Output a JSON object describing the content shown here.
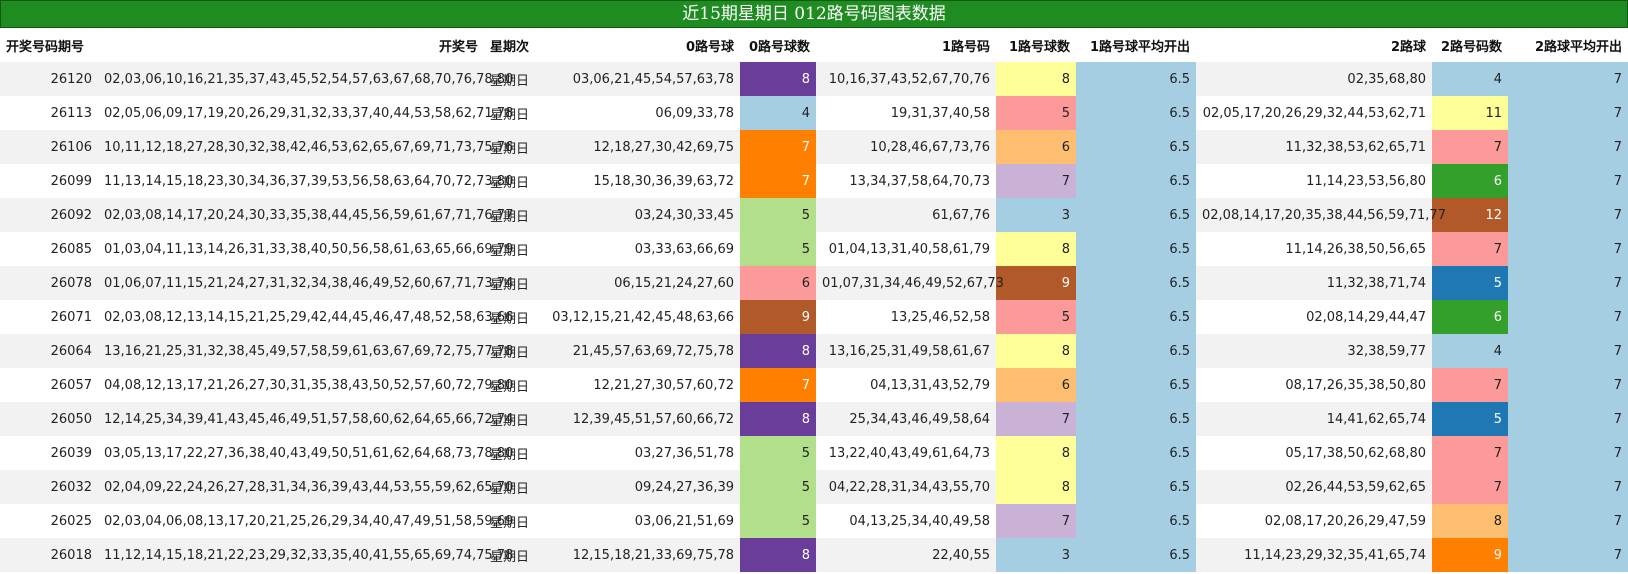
{
  "title": "近15期星期日 012路号码图表数据",
  "headers": [
    "开奖号码期号",
    "开奖号",
    "星期次",
    "0路号球",
    "0路号球数",
    "1路号码",
    "1路号球数",
    "1路号球平均开出",
    "2路球",
    "2路号码数",
    "2路球平均开出"
  ],
  "colors": {
    "purple": "#6a3d9a",
    "light_blue": "#a6cee3",
    "orange": "#ff7f00",
    "light_green": "#b2df8a",
    "pink": "#fb9a99",
    "brown": "#b15928",
    "yellow": "#ffff99",
    "light_orange": "#fdbf6f",
    "lavender": "#cab2d6",
    "blue": "#1f78b4",
    "green": "#33a02c"
  },
  "rows": [
    {
      "period": "26120",
      "numbers": "02,03,06,10,16,21,35,37,43,45,52,54,57,63,67,68,70,76,78,80",
      "weekday": "星期日",
      "r0": "03,06,21,45,54,57,63,78",
      "r0_count": "8",
      "r0_color": "#6a3d9a",
      "r0_text": "#ffffff",
      "r1": "10,16,37,43,52,67,70,76",
      "r1_count": "8",
      "r1_color": "#ffff99",
      "r1_text": "#222222",
      "r1_avg": "6.5",
      "r2": "02,35,68,80",
      "r2_count": "4",
      "r2_color": "#a6cee3",
      "r2_text": "#222222",
      "r2_avg": "7"
    },
    {
      "period": "26113",
      "numbers": "02,05,06,09,17,19,20,26,29,31,32,33,37,40,44,53,58,62,71,78",
      "weekday": "星期日",
      "r0": "06,09,33,78",
      "r0_count": "4",
      "r0_color": "#a6cee3",
      "r0_text": "#222222",
      "r1": "19,31,37,40,58",
      "r1_count": "5",
      "r1_color": "#fb9a99",
      "r1_text": "#222222",
      "r1_avg": "6.5",
      "r2": "02,05,17,20,26,29,32,44,53,62,71",
      "r2_count": "11",
      "r2_color": "#ffff99",
      "r2_text": "#222222",
      "r2_avg": "7"
    },
    {
      "period": "26106",
      "numbers": "10,11,12,18,27,28,30,32,38,42,46,53,62,65,67,69,71,73,75,76",
      "weekday": "星期日",
      "r0": "12,18,27,30,42,69,75",
      "r0_count": "7",
      "r0_color": "#ff7f00",
      "r0_text": "#ffffff",
      "r1": "10,28,46,67,73,76",
      "r1_count": "6",
      "r1_color": "#fdbf6f",
      "r1_text": "#222222",
      "r1_avg": "6.5",
      "r2": "11,32,38,53,62,65,71",
      "r2_count": "7",
      "r2_color": "#fb9a99",
      "r2_text": "#222222",
      "r2_avg": "7"
    },
    {
      "period": "26099",
      "numbers": "11,13,14,15,18,23,30,34,36,37,39,53,56,58,63,64,70,72,73,80",
      "weekday": "星期日",
      "r0": "15,18,30,36,39,63,72",
      "r0_count": "7",
      "r0_color": "#ff7f00",
      "r0_text": "#ffffff",
      "r1": "13,34,37,58,64,70,73",
      "r1_count": "7",
      "r1_color": "#cab2d6",
      "r1_text": "#222222",
      "r1_avg": "6.5",
      "r2": "11,14,23,53,56,80",
      "r2_count": "6",
      "r2_color": "#33a02c",
      "r2_text": "#ffffff",
      "r2_avg": "7"
    },
    {
      "period": "26092",
      "numbers": "02,03,08,14,17,20,24,30,33,35,38,44,45,56,59,61,67,71,76,77",
      "weekday": "星期日",
      "r0": "03,24,30,33,45",
      "r0_count": "5",
      "r0_color": "#b2df8a",
      "r0_text": "#222222",
      "r1": "61,67,76",
      "r1_count": "3",
      "r1_color": "#a6cee3",
      "r1_text": "#222222",
      "r1_avg": "6.5",
      "r2": "02,08,14,17,20,35,38,44,56,59,71,77",
      "r2_count": "12",
      "r2_color": "#b15928",
      "r2_text": "#ffffff",
      "r2_avg": "7"
    },
    {
      "period": "26085",
      "numbers": "01,03,04,11,13,14,26,31,33,38,40,50,56,58,61,63,65,66,69,79",
      "weekday": "星期日",
      "r0": "03,33,63,66,69",
      "r0_count": "5",
      "r0_color": "#b2df8a",
      "r0_text": "#222222",
      "r1": "01,04,13,31,40,58,61,79",
      "r1_count": "8",
      "r1_color": "#ffff99",
      "r1_text": "#222222",
      "r1_avg": "6.5",
      "r2": "11,14,26,38,50,56,65",
      "r2_count": "7",
      "r2_color": "#fb9a99",
      "r2_text": "#222222",
      "r2_avg": "7"
    },
    {
      "period": "26078",
      "numbers": "01,06,07,11,15,21,24,27,31,32,34,38,46,49,52,60,67,71,73,74",
      "weekday": "星期日",
      "r0": "06,15,21,24,27,60",
      "r0_count": "6",
      "r0_color": "#fb9a99",
      "r0_text": "#222222",
      "r1": "01,07,31,34,46,49,52,67,73",
      "r1_count": "9",
      "r1_color": "#b15928",
      "r1_text": "#ffffff",
      "r1_avg": "6.5",
      "r2": "11,32,38,71,74",
      "r2_count": "5",
      "r2_color": "#1f78b4",
      "r2_text": "#ffffff",
      "r2_avg": "7"
    },
    {
      "period": "26071",
      "numbers": "02,03,08,12,13,14,15,21,25,29,42,44,45,46,47,48,52,58,63,66",
      "weekday": "星期日",
      "r0": "03,12,15,21,42,45,48,63,66",
      "r0_count": "9",
      "r0_color": "#b15928",
      "r0_text": "#ffffff",
      "r1": "13,25,46,52,58",
      "r1_count": "5",
      "r1_color": "#fb9a99",
      "r1_text": "#222222",
      "r1_avg": "6.5",
      "r2": "02,08,14,29,44,47",
      "r2_count": "6",
      "r2_color": "#33a02c",
      "r2_text": "#ffffff",
      "r2_avg": "7"
    },
    {
      "period": "26064",
      "numbers": "13,16,21,25,31,32,38,45,49,57,58,59,61,63,67,69,72,75,77,78",
      "weekday": "星期日",
      "r0": "21,45,57,63,69,72,75,78",
      "r0_count": "8",
      "r0_color": "#6a3d9a",
      "r0_text": "#ffffff",
      "r1": "13,16,25,31,49,58,61,67",
      "r1_count": "8",
      "r1_color": "#ffff99",
      "r1_text": "#222222",
      "r1_avg": "6.5",
      "r2": "32,38,59,77",
      "r2_count": "4",
      "r2_color": "#a6cee3",
      "r2_text": "#222222",
      "r2_avg": "7"
    },
    {
      "period": "26057",
      "numbers": "04,08,12,13,17,21,26,27,30,31,35,38,43,50,52,57,60,72,79,80",
      "weekday": "星期日",
      "r0": "12,21,27,30,57,60,72",
      "r0_count": "7",
      "r0_color": "#ff7f00",
      "r0_text": "#ffffff",
      "r1": "04,13,31,43,52,79",
      "r1_count": "6",
      "r1_color": "#fdbf6f",
      "r1_text": "#222222",
      "r1_avg": "6.5",
      "r2": "08,17,26,35,38,50,80",
      "r2_count": "7",
      "r2_color": "#fb9a99",
      "r2_text": "#222222",
      "r2_avg": "7"
    },
    {
      "period": "26050",
      "numbers": "12,14,25,34,39,41,43,45,46,49,51,57,58,60,62,64,65,66,72,74",
      "weekday": "星期日",
      "r0": "12,39,45,51,57,60,66,72",
      "r0_count": "8",
      "r0_color": "#6a3d9a",
      "r0_text": "#ffffff",
      "r1": "25,34,43,46,49,58,64",
      "r1_count": "7",
      "r1_color": "#cab2d6",
      "r1_text": "#222222",
      "r1_avg": "6.5",
      "r2": "14,41,62,65,74",
      "r2_count": "5",
      "r2_color": "#1f78b4",
      "r2_text": "#ffffff",
      "r2_avg": "7"
    },
    {
      "period": "26039",
      "numbers": "03,05,13,17,22,27,36,38,40,43,49,50,51,61,62,64,68,73,78,80",
      "weekday": "星期日",
      "r0": "03,27,36,51,78",
      "r0_count": "5",
      "r0_color": "#b2df8a",
      "r0_text": "#222222",
      "r1": "13,22,40,43,49,61,64,73",
      "r1_count": "8",
      "r1_color": "#ffff99",
      "r1_text": "#222222",
      "r1_avg": "6.5",
      "r2": "05,17,38,50,62,68,80",
      "r2_count": "7",
      "r2_color": "#fb9a99",
      "r2_text": "#222222",
      "r2_avg": "7"
    },
    {
      "period": "26032",
      "numbers": "02,04,09,22,24,26,27,28,31,34,36,39,43,44,53,55,59,62,65,70",
      "weekday": "星期日",
      "r0": "09,24,27,36,39",
      "r0_count": "5",
      "r0_color": "#b2df8a",
      "r0_text": "#222222",
      "r1": "04,22,28,31,34,43,55,70",
      "r1_count": "8",
      "r1_color": "#ffff99",
      "r1_text": "#222222",
      "r1_avg": "6.5",
      "r2": "02,26,44,53,59,62,65",
      "r2_count": "7",
      "r2_color": "#fb9a99",
      "r2_text": "#222222",
      "r2_avg": "7"
    },
    {
      "period": "26025",
      "numbers": "02,03,04,06,08,13,17,20,21,25,26,29,34,40,47,49,51,58,59,69",
      "weekday": "星期日",
      "r0": "03,06,21,51,69",
      "r0_count": "5",
      "r0_color": "#b2df8a",
      "r0_text": "#222222",
      "r1": "04,13,25,34,40,49,58",
      "r1_count": "7",
      "r1_color": "#cab2d6",
      "r1_text": "#222222",
      "r1_avg": "6.5",
      "r2": "02,08,17,20,26,29,47,59",
      "r2_count": "8",
      "r2_color": "#fdbf6f",
      "r2_text": "#222222",
      "r2_avg": "7"
    },
    {
      "period": "26018",
      "numbers": "11,12,14,15,18,21,22,23,29,32,33,35,40,41,55,65,69,74,75,78",
      "weekday": "星期日",
      "r0": "12,15,18,21,33,69,75,78",
      "r0_count": "8",
      "r0_color": "#6a3d9a",
      "r0_text": "#ffffff",
      "r1": "22,40,55",
      "r1_count": "3",
      "r1_color": "#a6cee3",
      "r1_text": "#222222",
      "r1_avg": "6.5",
      "r2": "11,14,23,29,32,35,41,65,74",
      "r2_count": "9",
      "r2_color": "#ff7f00",
      "r2_text": "#ffffff",
      "r2_avg": "7"
    }
  ]
}
